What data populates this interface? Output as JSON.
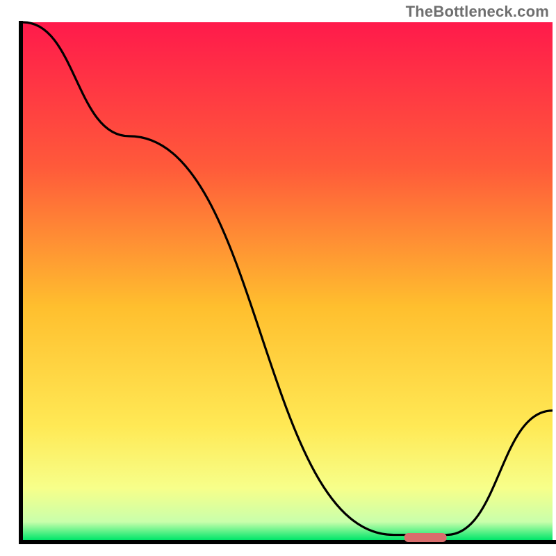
{
  "watermark": "TheBottleneck.com",
  "chart_data": {
    "type": "line",
    "title": "",
    "xlabel": "",
    "ylabel": "",
    "xlim": [
      0,
      100
    ],
    "ylim": [
      0,
      100
    ],
    "grid": false,
    "legend": false,
    "x": [
      0,
      20,
      70,
      80,
      100
    ],
    "values": [
      100,
      78,
      1,
      1,
      25
    ],
    "series": [
      {
        "name": "bottleneck-curve",
        "x": [
          0,
          20,
          70,
          80,
          100
        ],
        "values": [
          100,
          78,
          1,
          1,
          25
        ]
      }
    ],
    "marker": {
      "name": "optimal-range",
      "x_start": 72,
      "x_end": 80,
      "color": "#d96d6c"
    },
    "gradient_stops": [
      {
        "pos": 0.0,
        "color": "#ff1a4b"
      },
      {
        "pos": 0.28,
        "color": "#ff5a3a"
      },
      {
        "pos": 0.55,
        "color": "#ffbf2e"
      },
      {
        "pos": 0.78,
        "color": "#ffe955"
      },
      {
        "pos": 0.9,
        "color": "#f7ff8a"
      },
      {
        "pos": 0.965,
        "color": "#c9ffab"
      },
      {
        "pos": 1.0,
        "color": "#00e66a"
      }
    ]
  }
}
